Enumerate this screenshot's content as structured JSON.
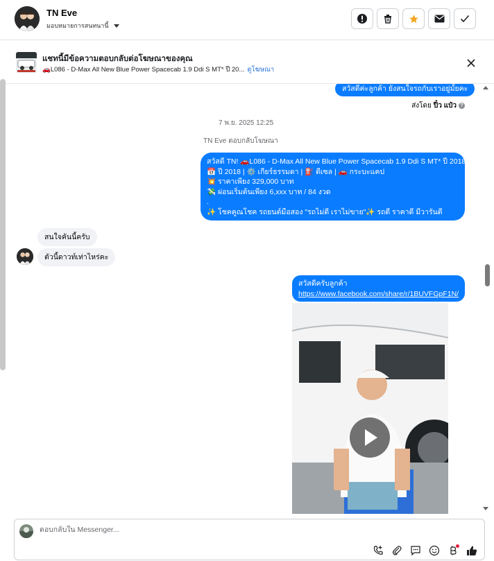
{
  "header": {
    "name": "TN Eve",
    "assign_label": "มอบหมายการสนทนานี้",
    "buttons": [
      "spam-icon",
      "trash-icon",
      "star-icon",
      "mail-icon",
      "check-icon"
    ],
    "accent_star": "#f5a623"
  },
  "ad_banner": {
    "title": "แชทนี้มีข้อความตอบกลับต่อโฆษณาของคุณ",
    "subtitle": "🚗L086 - D-Max All New Blue Power Spacecab 1.9 Ddi S MT* ปี 20...",
    "link": "ดูโฆษณา"
  },
  "messages": {
    "top_outgoing": "สวัสดีค่ะลูกค้า ยังสนใจรถกับเราอยู่มั้ยคะ",
    "sent_by_prefix": "ส่งโดย",
    "sent_by_name": "ปิ๋ว แป๋ว",
    "timestamp": "7 พ.ย. 2025 12:25",
    "reply_note": "TN Eve ตอบกลับโฆษณา",
    "ad_message": {
      "line1": "สวัสดี TN! 🚗L086 - D-Max All New Blue Power Spacecab 1.9 Ddi S MT* ปี 2018",
      "line2": "📅 ปี 2018 | ⚙️ เกียร์ธรรมดา | ⛽ ดีเซล | 🚗 กระบะแคป",
      "line3": "💥 ราคาเพียง 329,000 บาท",
      "line4": "💸 ผ่อนเริ่มต้นเพียง 6,xxx บาท / 84 งวด",
      "line5": ".",
      "line6": "✨ โชคคูณโชค รถยนต์มือสอง \"รถไม่ดี เราไม่ขาย\"✨ รถดี ราคาดี มีวารันตี"
    },
    "in1": "สนใจคันนี้ครับ",
    "in2": "ตัวนี้ดาวท์เท่าไหร่คะ",
    "out_greet": "สวัสดีครับลูกค้า",
    "out_link": "https://www.facebook.com/share/r/1BUVFGpF1N/"
  },
  "composer": {
    "placeholder": "ตอบกลับใน Messenger...",
    "tools": [
      "call-add-icon",
      "attachment-icon",
      "saved-reply-icon",
      "emoji-icon",
      "payment-icon",
      "like-icon"
    ]
  },
  "colors": {
    "outgoing_bubble": "#0a7cff",
    "incoming_bubble": "#f0f2f5",
    "link": "#216fdb"
  }
}
